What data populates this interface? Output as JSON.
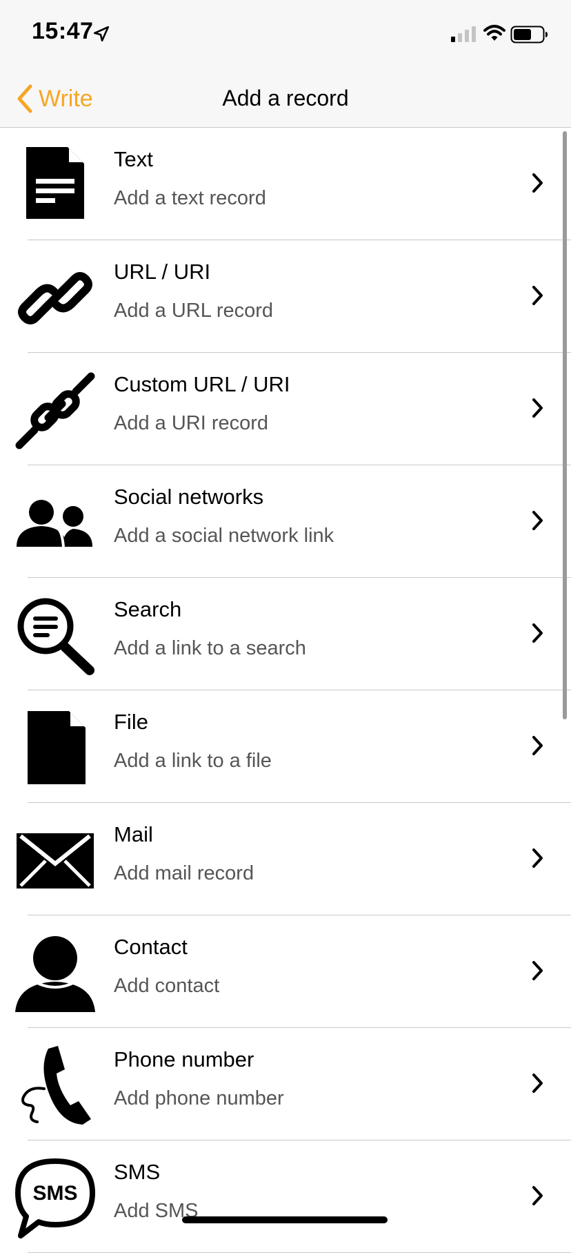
{
  "status_bar": {
    "time": "15:47",
    "icons": [
      "location-arrow-icon",
      "signal-icon",
      "wifi-icon",
      "battery-icon"
    ]
  },
  "nav": {
    "back_label": "Write",
    "title": "Add a record",
    "accent_color": "#f6a623"
  },
  "records": [
    {
      "title": "Text",
      "subtitle": "Add a text record",
      "icon": "document-icon"
    },
    {
      "title": "URL / URI",
      "subtitle": "Add a URL record",
      "icon": "link-icon"
    },
    {
      "title": "Custom URL / URI",
      "subtitle": "Add a URI record",
      "icon": "custom-link-icon"
    },
    {
      "title": "Social networks",
      "subtitle": "Add a social network link",
      "icon": "people-icon"
    },
    {
      "title": "Search",
      "subtitle": "Add a link to a search",
      "icon": "search-icon"
    },
    {
      "title": "File",
      "subtitle": "Add a link to a file",
      "icon": "file-icon"
    },
    {
      "title": "Mail",
      "subtitle": "Add mail record",
      "icon": "mail-icon"
    },
    {
      "title": "Contact",
      "subtitle": "Add contact",
      "icon": "contact-icon"
    },
    {
      "title": "Phone number",
      "subtitle": "Add phone number",
      "icon": "phone-icon"
    },
    {
      "title": "SMS",
      "subtitle": "Add SMS",
      "icon": "sms-icon",
      "icon_text": "SMS"
    }
  ]
}
